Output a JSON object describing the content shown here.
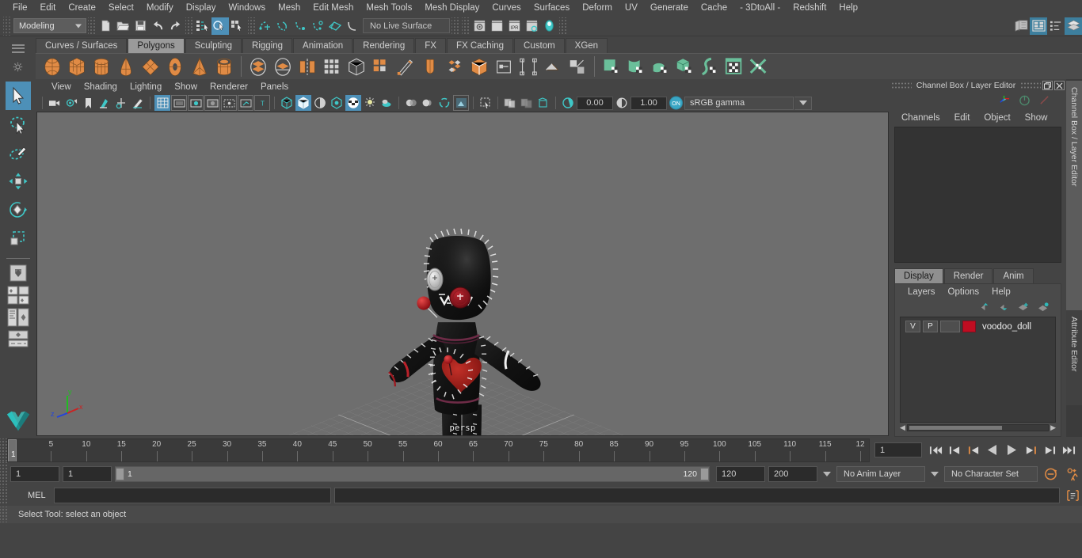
{
  "app": {
    "name": "Autodesk Maya"
  },
  "menubar": {
    "items": [
      {
        "label": "File"
      },
      {
        "label": "Edit"
      },
      {
        "label": "Create"
      },
      {
        "label": "Select"
      },
      {
        "label": "Modify"
      },
      {
        "label": "Display"
      },
      {
        "label": "Windows"
      },
      {
        "label": "Mesh"
      },
      {
        "label": "Edit Mesh"
      },
      {
        "label": "Mesh Tools"
      },
      {
        "label": "Mesh Display"
      },
      {
        "label": "Curves"
      },
      {
        "label": "Surfaces"
      },
      {
        "label": "Deform"
      },
      {
        "label": "UV"
      },
      {
        "label": "Generate"
      },
      {
        "label": "Cache"
      },
      {
        "label": "- 3DtoAll -"
      },
      {
        "label": "Redshift"
      },
      {
        "label": "Help"
      }
    ]
  },
  "statusline": {
    "menu_set": "Modeling",
    "live_surface": "No Live Surface",
    "icons": [
      {
        "name": "new-scene-icon"
      },
      {
        "name": "open-scene-icon"
      },
      {
        "name": "save-scene-icon"
      },
      {
        "name": "undo-icon"
      },
      {
        "name": "redo-icon"
      },
      {
        "name": "select-by-hierarchy-icon"
      },
      {
        "name": "select-by-object-icon"
      },
      {
        "name": "select-by-component-icon"
      },
      {
        "name": "snap-to-grid-icon"
      },
      {
        "name": "snap-to-curve-icon"
      },
      {
        "name": "snap-to-point-icon"
      },
      {
        "name": "snap-to-projected-center-icon"
      },
      {
        "name": "snap-to-view-plane-icon"
      },
      {
        "name": "make-live-icon"
      },
      {
        "name": "render-current-frame-icon"
      },
      {
        "name": "render-sequence-icon"
      },
      {
        "name": "ipr-render-icon"
      },
      {
        "name": "render-settings-icon"
      },
      {
        "name": "hypershade-icon"
      },
      {
        "name": "show-hide-editors-icon"
      },
      {
        "name": "show-attribute-editor-icon"
      },
      {
        "name": "show-tool-settings-icon"
      },
      {
        "name": "show-channel-box-icon"
      }
    ]
  },
  "shelf": {
    "tabs": [
      {
        "label": "Curves / Surfaces",
        "active": false
      },
      {
        "label": "Polygons",
        "active": true
      },
      {
        "label": "Sculpting",
        "active": false
      },
      {
        "label": "Rigging",
        "active": false
      },
      {
        "label": "Animation",
        "active": false
      },
      {
        "label": "Rendering",
        "active": false
      },
      {
        "label": "FX",
        "active": false
      },
      {
        "label": "FX Caching",
        "active": false
      },
      {
        "label": "Custom",
        "active": false
      },
      {
        "label": "XGen",
        "active": false
      }
    ],
    "icons": [
      {
        "name": "polygon-sphere-icon",
        "color": "#e08b45",
        "shape": "sphere"
      },
      {
        "name": "polygon-cube-icon",
        "color": "#e08b45",
        "shape": "cube"
      },
      {
        "name": "polygon-cylinder-icon",
        "color": "#e08b45",
        "shape": "cylinder"
      },
      {
        "name": "polygon-cone-icon",
        "color": "#e08b45",
        "shape": "cone"
      },
      {
        "name": "polygon-plane-icon",
        "color": "#e08b45",
        "shape": "plane"
      },
      {
        "name": "polygon-torus-icon",
        "color": "#e08b45",
        "shape": "torus"
      },
      {
        "name": "polygon-pyramid-icon",
        "color": "#e08b45",
        "shape": "pyramid"
      },
      {
        "name": "polygon-pipe-icon",
        "color": "#e08b45",
        "shape": "pipe"
      },
      {
        "name": "combine-icon",
        "color": "#e08b45",
        "shape": "combine"
      },
      {
        "name": "separate-icon",
        "color": "#e08b45",
        "shape": "separate"
      },
      {
        "name": "mirror-geometry-icon",
        "color": "#e08b45",
        "shape": "mirror"
      },
      {
        "name": "smooth-icon",
        "color": "#cfcfcf",
        "shape": "grid"
      },
      {
        "name": "bevel-icon",
        "color": "#e08b45",
        "shape": "bevel"
      },
      {
        "name": "extrude-icon",
        "color": "#e08b45",
        "shape": "extrude"
      },
      {
        "name": "multi-cut-icon",
        "color": "#e08b45",
        "shape": "knife"
      },
      {
        "name": "target-weld-icon",
        "color": "#e08b45",
        "shape": "weld"
      },
      {
        "name": "multi-cut-tool-icon",
        "color": "#e08b45",
        "shape": "multicut"
      },
      {
        "name": "connect-icon",
        "color": "#e08b45",
        "shape": "connect"
      },
      {
        "name": "boolean-icon",
        "color": "#cfcfcf",
        "shape": "boolean"
      },
      {
        "name": "quad-draw-icon",
        "color": "#cfcfcf",
        "shape": "quaddraw"
      },
      {
        "name": "crease-icon",
        "color": "#cfcfcf",
        "shape": "crease"
      },
      {
        "name": "uv-editor-icon",
        "color": "#cfcfcf",
        "shape": "uvedit"
      },
      {
        "name": "planar-mapping-icon",
        "color": "#6abf9a",
        "shape": "planar"
      },
      {
        "name": "cylindrical-mapping-icon",
        "color": "#6abf9a",
        "shape": "cylmap"
      },
      {
        "name": "spherical-mapping-icon",
        "color": "#6abf9a",
        "shape": "sphmap"
      },
      {
        "name": "automatic-mapping-icon",
        "color": "#6abf9a",
        "shape": "automap"
      },
      {
        "name": "uv-unfold-icon",
        "color": "#6abf9a",
        "shape": "unfold"
      },
      {
        "name": "uv-texture-editor-icon",
        "color": "#6abf9a",
        "shape": "uvtex"
      },
      {
        "name": "uv-cut-sew-icon",
        "color": "#6abf9a",
        "shape": "cutsew"
      }
    ]
  },
  "toolbox": {
    "tools": [
      {
        "name": "select-tool",
        "label": "Select Tool",
        "active": true
      },
      {
        "name": "lasso-select-tool",
        "label": "Lasso Tool",
        "active": false
      },
      {
        "name": "paint-select-tool",
        "label": "Paint Selection Tool",
        "active": false
      },
      {
        "name": "move-tool",
        "label": "Move Tool",
        "active": false
      },
      {
        "name": "rotate-tool",
        "label": "Rotate Tool",
        "active": false
      },
      {
        "name": "scale-tool",
        "label": "Scale Tool",
        "active": false
      }
    ],
    "layouts": [
      {
        "name": "single-perspective-layout"
      },
      {
        "name": "four-view-layout"
      },
      {
        "name": "persp-outliner-layout"
      },
      {
        "name": "persp-graph-layout"
      }
    ],
    "logo": "maya-logo-icon"
  },
  "viewport": {
    "menus": [
      {
        "label": "View"
      },
      {
        "label": "Shading"
      },
      {
        "label": "Lighting"
      },
      {
        "label": "Show"
      },
      {
        "label": "Renderer"
      },
      {
        "label": "Panels"
      }
    ],
    "toolbar": {
      "exposure": "0.00",
      "gamma": "1.00",
      "color_space": "sRGB gamma",
      "view_transform_toggle": "ON",
      "icons": [
        {
          "name": "select-camera-icon",
          "active": false
        },
        {
          "name": "camera-attributes-icon",
          "active": false
        },
        {
          "name": "bookmark-icon",
          "active": false
        },
        {
          "name": "image-plane-icon",
          "active": false
        },
        {
          "name": "two-d-pan-zoom-icon",
          "active": false
        },
        {
          "name": "grease-pencil-icon",
          "active": false
        },
        {
          "name": "grid-toggle-icon",
          "active": true
        },
        {
          "name": "film-gate-icon",
          "active": false
        },
        {
          "name": "resolution-gate-icon",
          "active": false
        },
        {
          "name": "gate-mask-icon",
          "active": false
        },
        {
          "name": "film-origin-icon",
          "active": false
        },
        {
          "name": "safe-action-icon",
          "active": false
        },
        {
          "name": "field-chart-icon",
          "active": false
        },
        {
          "name": "wireframe-shading-icon",
          "active": false
        },
        {
          "name": "smooth-shade-all-icon",
          "active": true
        },
        {
          "name": "shade-wireframe-icon",
          "active": false
        },
        {
          "name": "use-all-lights-icon",
          "active": false
        },
        {
          "name": "textured-mode-icon",
          "active": true
        },
        {
          "name": "use-default-lighting-icon",
          "active": false
        },
        {
          "name": "shadows-icon",
          "active": false
        },
        {
          "name": "screen-space-ao-icon",
          "active": false
        },
        {
          "name": "motion-blur-icon",
          "active": false
        },
        {
          "name": "multisample-aa-icon",
          "active": false
        },
        {
          "name": "depth-of-field-icon",
          "active": false
        },
        {
          "name": "isolate-select-icon",
          "active": false
        },
        {
          "name": "xray-icon",
          "active": false
        },
        {
          "name": "xray-joints-icon",
          "active": false
        },
        {
          "name": "xray-active-components-icon",
          "active": false
        },
        {
          "name": "exposure-icon",
          "active": false
        },
        {
          "name": "gamma-icon",
          "active": false
        }
      ]
    },
    "camera_label": "persp",
    "axis_labels": {
      "x": "x",
      "y": "y",
      "z": "z"
    },
    "axis_colors": {
      "x": "#cc2222",
      "y": "#22bb22",
      "z": "#2244dd"
    },
    "background_color": "#6e6e6e",
    "scene_object": "voodoo_doll"
  },
  "channel_box": {
    "title": "Channel Box / Layer Editor",
    "window_buttons": [
      {
        "name": "undock-button",
        "glyph": "❐"
      },
      {
        "name": "close-button",
        "glyph": "✕"
      }
    ],
    "top_icons": [
      {
        "name": "channel-box-icon"
      },
      {
        "name": "attribute-editor-toggle-icon"
      },
      {
        "name": "modeling-toolkit-icon"
      }
    ],
    "menus": [
      {
        "label": "Channels"
      },
      {
        "label": "Edit"
      },
      {
        "label": "Object"
      },
      {
        "label": "Show"
      }
    ],
    "content": ""
  },
  "layer_editor": {
    "tabs": [
      {
        "label": "Display",
        "active": true
      },
      {
        "label": "Render",
        "active": false
      },
      {
        "label": "Anim",
        "active": false
      }
    ],
    "menus": [
      {
        "label": "Layers"
      },
      {
        "label": "Options"
      },
      {
        "label": "Help"
      }
    ],
    "buttons": [
      {
        "name": "move-layer-up-icon"
      },
      {
        "name": "move-layer-down-icon"
      },
      {
        "name": "new-layer-icon"
      },
      {
        "name": "new-layer-from-selected-icon"
      }
    ],
    "layers": [
      {
        "visibility": "V",
        "playback": "P",
        "type": "",
        "color": "#c00d21",
        "name": "voodoo_doll"
      }
    ]
  },
  "right_tabs": [
    {
      "label": "Channel Box / Layer Editor",
      "active": true
    },
    {
      "label": "Attribute Editor",
      "active": false
    }
  ],
  "time_slider": {
    "start": 1,
    "end": 120,
    "current_frame": "1",
    "tick_labels": [
      "5",
      "10",
      "15",
      "20",
      "25",
      "30",
      "35",
      "40",
      "45",
      "50",
      "55",
      "60",
      "65",
      "70",
      "75",
      "80",
      "85",
      "90",
      "95",
      "100",
      "105",
      "110",
      "115",
      "12"
    ],
    "playback_buttons": [
      {
        "name": "go-to-start-button"
      },
      {
        "name": "step-back-keyframe-button"
      },
      {
        "name": "step-back-frame-button"
      },
      {
        "name": "play-backwards-button"
      },
      {
        "name": "play-forwards-button"
      },
      {
        "name": "step-forward-frame-button"
      },
      {
        "name": "step-forward-keyframe-button"
      },
      {
        "name": "go-to-end-button"
      }
    ]
  },
  "range_slider": {
    "anim_start": "1",
    "range_start": "1",
    "bar_start_label": "1",
    "bar_end_label": "120",
    "range_end": "120",
    "anim_end": "200",
    "anim_layer": "No Anim Layer",
    "character_set": "No Character Set",
    "buttons": [
      {
        "name": "auto-keyframe-toggle-icon"
      },
      {
        "name": "animation-preferences-icon"
      }
    ]
  },
  "command_line": {
    "language_label": "MEL",
    "input_value": "",
    "output_value": "",
    "script_editor_icon": "script-editor-icon"
  },
  "status_bar": {
    "message": "Select Tool: select an object"
  }
}
